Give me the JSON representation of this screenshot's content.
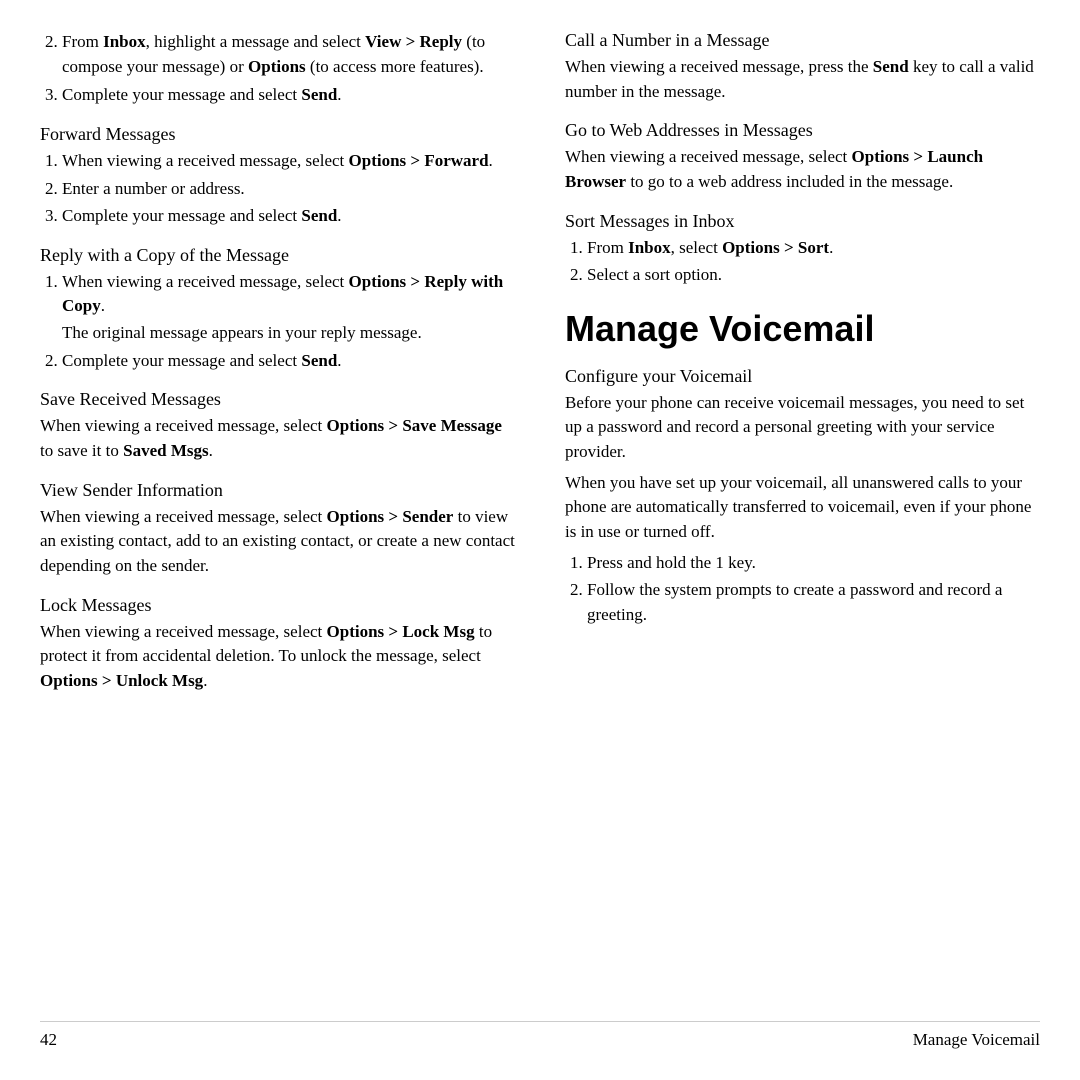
{
  "left_col": {
    "intro_items": [
      {
        "num": "2.",
        "text_parts": [
          {
            "text": "From ",
            "bold": false
          },
          {
            "text": "Inbox",
            "bold": true
          },
          {
            "text": ", highlight a message and select ",
            "bold": false
          },
          {
            "text": "View > Reply",
            "bold": true
          },
          {
            "text": " (to compose your message) or ",
            "bold": false
          },
          {
            "text": "Options",
            "bold": true
          },
          {
            "text": " (to access more features).",
            "bold": false
          }
        ]
      },
      {
        "num": "3.",
        "text_parts": [
          {
            "text": "Complete your message and select ",
            "bold": false
          },
          {
            "text": "Send",
            "bold": true
          },
          {
            "text": ".",
            "bold": false
          }
        ]
      }
    ],
    "sections": [
      {
        "title": "Forward Messages",
        "items": [
          {
            "type": "ol",
            "entries": [
              {
                "text_parts": [
                  {
                    "text": "When viewing a received message, select ",
                    "bold": false
                  },
                  {
                    "text": "Options > Forward",
                    "bold": true
                  },
                  {
                    "text": ".",
                    "bold": false
                  }
                ]
              },
              {
                "text_parts": [
                  {
                    "text": "Enter a number or address.",
                    "bold": false
                  }
                ]
              },
              {
                "text_parts": [
                  {
                    "text": "Complete your message and select ",
                    "bold": false
                  },
                  {
                    "text": "Send",
                    "bold": true
                  },
                  {
                    "text": ".",
                    "bold": false
                  }
                ]
              }
            ]
          }
        ]
      },
      {
        "title": "Reply with a Copy of the Message",
        "items": [
          {
            "type": "ol",
            "entries": [
              {
                "text_parts": [
                  {
                    "text": "When viewing a received message, select ",
                    "bold": false
                  },
                  {
                    "text": "Options > Reply with Copy",
                    "bold": true
                  },
                  {
                    "text": ".",
                    "bold": false
                  }
                ],
                "subtext": "The original message appears in your reply message."
              },
              {
                "text_parts": [
                  {
                    "text": "Complete your message and select ",
                    "bold": false
                  },
                  {
                    "text": "Send",
                    "bold": true
                  },
                  {
                    "text": ".",
                    "bold": false
                  }
                ]
              }
            ]
          }
        ]
      },
      {
        "title": "Save Received Messages",
        "items": [
          {
            "type": "p",
            "text_parts": [
              {
                "text": "When viewing a received message, select ",
                "bold": false
              },
              {
                "text": "Options > Save Message",
                "bold": true
              },
              {
                "text": " to save it to ",
                "bold": false
              },
              {
                "text": "Saved Msgs",
                "bold": true
              },
              {
                "text": ".",
                "bold": false
              }
            ]
          }
        ]
      },
      {
        "title": "View Sender Information",
        "items": [
          {
            "type": "p",
            "text_parts": [
              {
                "text": "When viewing a received message, select ",
                "bold": false
              },
              {
                "text": "Options > Sender",
                "bold": true
              },
              {
                "text": " to view an existing contact, add to an existing contact, or create a new contact depending on the sender.",
                "bold": false
              }
            ]
          }
        ]
      },
      {
        "title": "Lock Messages",
        "items": [
          {
            "type": "p",
            "text_parts": [
              {
                "text": "When viewing a received message, select ",
                "bold": false
              },
              {
                "text": "Options > Lock Msg",
                "bold": true
              },
              {
                "text": " to protect it from accidental deletion. To unlock the message, select ",
                "bold": false
              },
              {
                "text": "Options > Unlock Msg",
                "bold": true
              },
              {
                "text": ".",
                "bold": false
              }
            ]
          }
        ]
      }
    ]
  },
  "right_col": {
    "sections": [
      {
        "title": "Call a Number in a Message",
        "items": [
          {
            "type": "p",
            "text_parts": [
              {
                "text": "When viewing a received message, press the ",
                "bold": false
              },
              {
                "text": "Send",
                "bold": true
              },
              {
                "text": " key to call a valid number in the message.",
                "bold": false
              }
            ]
          }
        ]
      },
      {
        "title": "Go to Web Addresses in Messages",
        "items": [
          {
            "type": "p",
            "text_parts": [
              {
                "text": "When viewing a received message, select ",
                "bold": false
              },
              {
                "text": "Options > Launch Browser",
                "bold": true
              },
              {
                "text": " to go to a web address included in the message.",
                "bold": false
              }
            ]
          }
        ]
      },
      {
        "title": "Sort Messages in Inbox",
        "items": [
          {
            "type": "ol",
            "entries": [
              {
                "text_parts": [
                  {
                    "text": "From ",
                    "bold": false
                  },
                  {
                    "text": "Inbox",
                    "bold": true
                  },
                  {
                    "text": ", select ",
                    "bold": false
                  },
                  {
                    "text": "Options > Sort",
                    "bold": true
                  },
                  {
                    "text": ".",
                    "bold": false
                  }
                ]
              },
              {
                "text_parts": [
                  {
                    "text": "Select a sort option.",
                    "bold": false
                  }
                ]
              }
            ]
          }
        ]
      }
    ],
    "manage_voicemail": {
      "heading": "Manage Voicemail",
      "subsections": [
        {
          "title": "Configure your Voicemail",
          "paragraphs": [
            {
              "text_parts": [
                {
                  "text": "Before your phone can receive voicemail messages, you need to set up a password and record a personal greeting with your service provider.",
                  "bold": false
                }
              ]
            },
            {
              "text_parts": [
                {
                  "text": "When you have set up your voicemail, all unanswered calls to your phone are automatically transferred to voicemail, even if your phone is in use or turned off.",
                  "bold": false
                }
              ]
            }
          ],
          "ol": [
            {
              "text_parts": [
                {
                  "text": "Press and hold the 1 key.",
                  "bold": false
                }
              ]
            },
            {
              "text_parts": [
                {
                  "text": "Follow the system prompts to create a password and record a greeting.",
                  "bold": false
                }
              ]
            }
          ]
        }
      ]
    }
  },
  "footer": {
    "page_number": "42",
    "section_title": "Manage Voicemail"
  }
}
